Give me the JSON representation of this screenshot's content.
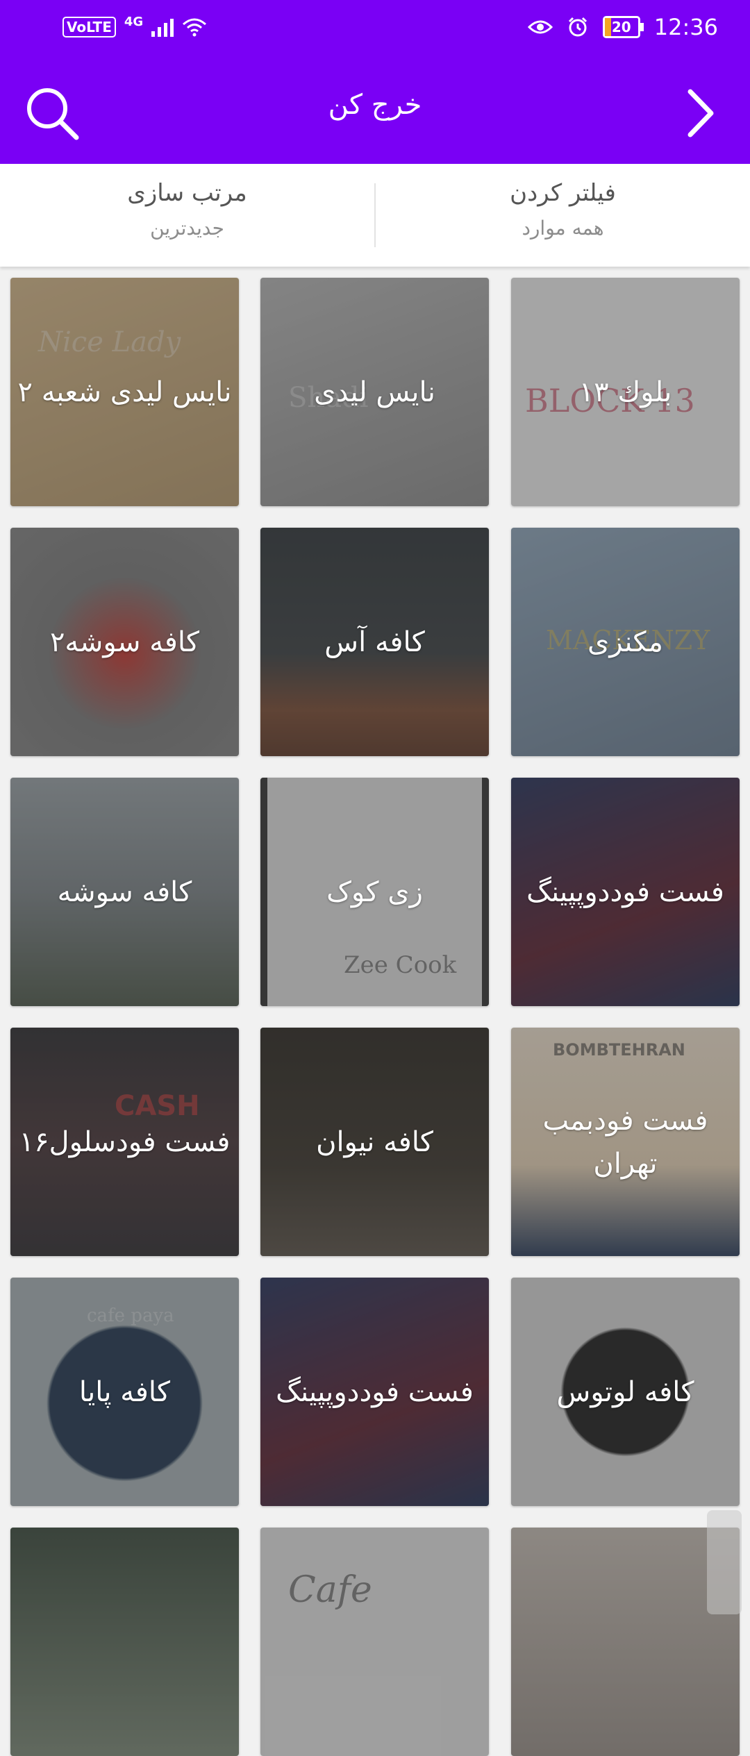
{
  "status_bar": {
    "network_badge": "VoLTE",
    "network_type": "4G",
    "battery": "20",
    "time": "12:36"
  },
  "app_bar": {
    "title": "خرج کن",
    "search_icon": "search-icon",
    "back_icon": "chevron-right-icon"
  },
  "options": {
    "filter_label": "فیلتر کردن",
    "filter_value": "همه موارد",
    "sort_label": "مرتب سازی",
    "sort_value": "جدیدترین"
  },
  "colors": {
    "primary": "#7a00f5",
    "background": "#f1f1f1"
  },
  "tiles": [
    {
      "name": "بلوك ۱۳",
      "photo_text": "BLOCK 13"
    },
    {
      "name": "نایس لیدی",
      "photo_text": "Shadi"
    },
    {
      "name": "نایس لیدی شعبه ۲",
      "photo_text": "Nice Lady"
    },
    {
      "name": "مکنزی",
      "photo_text": "MACKENZY"
    },
    {
      "name": "کافه آس",
      "photo_text": ""
    },
    {
      "name": "کافه سوشه۲",
      "photo_text": ""
    },
    {
      "name": "فست فوددوپپینگ",
      "photo_text": ""
    },
    {
      "name": "زی کوک",
      "photo_text": "Zee Cook"
    },
    {
      "name": "کافه سوشه",
      "photo_text": ""
    },
    {
      "name": "فست فودبمب تهران",
      "photo_text": "BOMBTEHRAN"
    },
    {
      "name": "کافه نیوان",
      "photo_text": ""
    },
    {
      "name": "فست فودسلول۱۶",
      "photo_text": "CASH"
    },
    {
      "name": "کافه لوتوس",
      "photo_text": ""
    },
    {
      "name": "فست فوددوپپینگ",
      "photo_text": ""
    },
    {
      "name": "کافه پایا",
      "photo_text": "cafe paya"
    },
    {
      "name": "",
      "photo_text": ""
    },
    {
      "name": "",
      "photo_text": "Cafe"
    },
    {
      "name": "",
      "photo_text": ""
    }
  ]
}
